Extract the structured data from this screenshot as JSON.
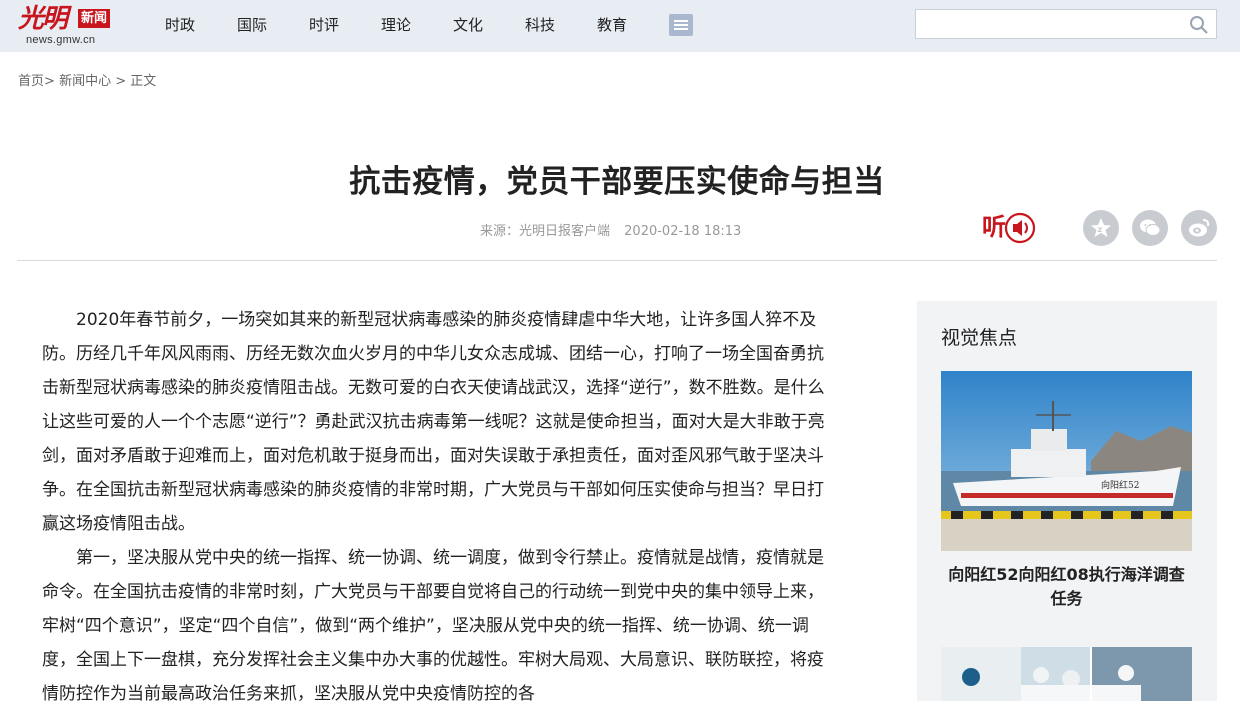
{
  "header": {
    "logo": {
      "brand": "光明",
      "tag": "新闻",
      "domain": "news.gmw.cn"
    },
    "nav": [
      "时政",
      "国际",
      "时评",
      "理论",
      "文化",
      "科技",
      "教育"
    ],
    "search": {
      "value": "",
      "placeholder": ""
    }
  },
  "breadcrumb": {
    "home": "首页",
    "sep1": ">",
    "news": "新闻中心",
    "sep2": ">",
    "current": "正文"
  },
  "article": {
    "title": "抗击疫情，党员干部要压实使命与担当",
    "source": "来源：光明日报客户端",
    "date": "2020-02-18 18:13",
    "listen_label": "听",
    "paragraphs": [
      "2020年春节前夕，一场突如其来的新型冠状病毒感染的肺炎疫情肆虐中华大地，让许多国人猝不及防。历经几千年风风雨雨、历经无数次血火岁月的中华儿女众志成城、团结一心，打响了一场全国奋勇抗击新型冠状病毒感染的肺炎疫情阻击战。无数可爱的白衣天使请战武汉，选择“逆行”，数不胜数。是什么让这些可爱的人一个个志愿“逆行”？勇赴武汉抗击病毒第一线呢？这就是使命担当，面对大是大非敢于亮剑，面对矛盾敢于迎难而上，面对危机敢于挺身而出，面对失误敢于承担责任，面对歪风邪气敢于坚决斗争。在全国抗击新型冠状病毒感染的肺炎疫情的非常时期，广大党员与干部如何压实使命与担当？早日打赢这场疫情阻击战。",
      "第一，坚决服从党中央的统一指挥、统一协调、统一调度，做到令行禁止。疫情就是战情，疫情就是命令。在全国抗击疫情的非常时刻，广大党员与干部要自觉将自己的行动统一到党中央的集中领导上来，牢树“四个意识”，坚定“四个自信”，做到“两个维护”，坚决服从党中央的统一指挥、统一协调、统一调度，全国上下一盘棋，充分发挥社会主义集中办大事的优越性。牢树大局观、大局意识、联防联控，将疫情防控作为当前最高政治任务来抓，坚决服从党中央疫情防控的各"
    ]
  },
  "sidebar": {
    "heading": "视觉焦点",
    "items": [
      {
        "caption": "向阳红52向阳红08执行海洋调查任务",
        "ship_text": "向阳红52"
      }
    ]
  },
  "colors": {
    "brand_red": "#c7161e",
    "topbar": "#e8edf3",
    "sidebar_bg": "#f2f3f5"
  }
}
